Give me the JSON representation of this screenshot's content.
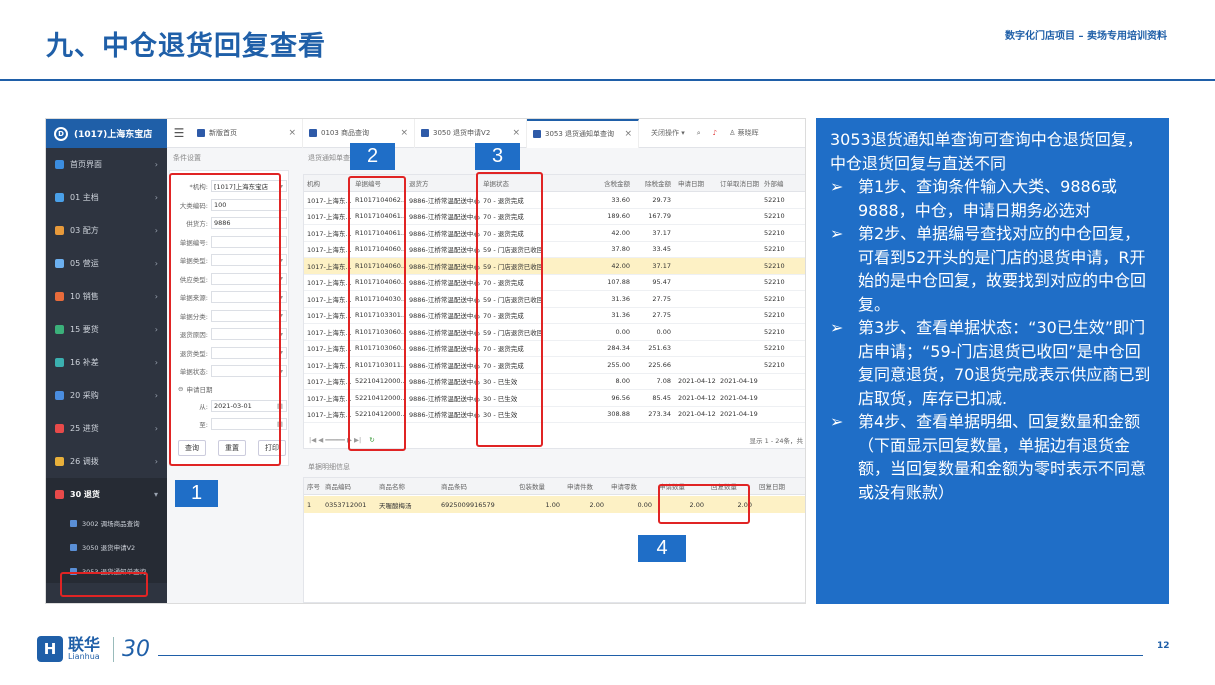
{
  "slide": {
    "title": "九、中仓退货回复查看",
    "subtitle": "数字化门店项目 – 卖场专用培训资料",
    "page": "12"
  },
  "sidebar": {
    "store": "(1017)上海东宝店",
    "items": [
      {
        "label": "首页界面",
        "color": "#3b8de0"
      },
      {
        "label": "01 主档",
        "color": "#4aa0e8"
      },
      {
        "label": "03 配方",
        "color": "#e89a3b"
      },
      {
        "label": "05 营运",
        "color": "#6cb0f0"
      },
      {
        "label": "10 销售",
        "color": "#e86b3b"
      },
      {
        "label": "15 要货",
        "color": "#3bb07a"
      },
      {
        "label": "16 补差",
        "color": "#3bb0b0"
      },
      {
        "label": "20 采购",
        "color": "#4a8de0"
      },
      {
        "label": "25 进货",
        "color": "#e84a4a"
      },
      {
        "label": "26 调拨",
        "color": "#e8b03b"
      },
      {
        "label": "30 退货",
        "color": "#e84a4a"
      }
    ],
    "sub_items": [
      {
        "label": "3002 调场商品查询"
      },
      {
        "label": "3050 退货申请V2"
      },
      {
        "label": "3053 退货通知单查询"
      }
    ]
  },
  "topbar": {
    "tabs": [
      {
        "label": "新版首页"
      },
      {
        "label": "0103 商品查询"
      },
      {
        "label": "3050 退货申请V2"
      },
      {
        "label": "3053 退货通知单查询"
      }
    ],
    "close_ops": "关闭操作 ▾",
    "user": "蔡晓晖"
  },
  "conditions": {
    "header": "条件设置",
    "fields": [
      {
        "label": "*机构:",
        "value": "[1017]上海东宝店",
        "dropdown": true
      },
      {
        "label": "大类编码:",
        "value": "100",
        "dropdown": false
      },
      {
        "label": "供货方:",
        "value": "9886",
        "dropdown": false
      },
      {
        "label": "单据编号:",
        "value": "",
        "dropdown": false
      },
      {
        "label": "单据类型:",
        "value": "",
        "dropdown": true
      },
      {
        "label": "供应类型:",
        "value": "",
        "dropdown": true
      },
      {
        "label": "单据来源:",
        "value": "",
        "dropdown": true
      },
      {
        "label": "单据分类:",
        "value": "",
        "dropdown": true
      },
      {
        "label": "退货原因:",
        "value": "",
        "dropdown": true
      },
      {
        "label": "退货类型:",
        "value": "",
        "dropdown": true
      },
      {
        "label": "单据状态:",
        "value": "",
        "dropdown": true
      }
    ],
    "date_group": "申请日期",
    "from_label": "从:",
    "from_value": "2021-03-01",
    "to_label": "至:",
    "to_value": "",
    "buttons": {
      "query": "查询",
      "reset": "重置",
      "print": "打印"
    }
  },
  "grid": {
    "title": "退货通知单查询",
    "columns": [
      "机构",
      "单据编号",
      "退货方",
      "单据状态",
      "含税金额",
      "除税金额",
      "申请日期",
      "订单取消日期",
      "外部编"
    ],
    "rows": [
      [
        "1017-上海东...",
        "R1017104062...",
        "9886-江桥常温配送中心...",
        "70 - 退货完成",
        "33.60",
        "29.73",
        "",
        "",
        "52210"
      ],
      [
        "1017-上海东...",
        "R1017104061...",
        "9886-江桥常温配送中心...",
        "70 - 退货完成",
        "189.60",
        "167.79",
        "",
        "",
        "52210"
      ],
      [
        "1017-上海东...",
        "R1017104061...",
        "9886-江桥常温配送中心...",
        "70 - 退货完成",
        "42.00",
        "37.17",
        "",
        "",
        "52210"
      ],
      [
        "1017-上海东...",
        "R1017104060...",
        "9886-江桥常温配送中心...",
        "59 - 门店退货已收回",
        "37.80",
        "33.45",
        "",
        "",
        "52210"
      ],
      [
        "1017-上海东...",
        "R1017104060...",
        "9886-江桥常温配送中心...",
        "59 - 门店退货已收回",
        "42.00",
        "37.17",
        "",
        "",
        "52210"
      ],
      [
        "1017-上海东...",
        "R1017104060...",
        "9886-江桥常温配送中心...",
        "70 - 退货完成",
        "107.88",
        "95.47",
        "",
        "",
        "52210"
      ],
      [
        "1017-上海东...",
        "R1017104030...",
        "9886-江桥常温配送中心...",
        "59 - 门店退货已收回",
        "31.36",
        "27.75",
        "",
        "",
        "52210"
      ],
      [
        "1017-上海东...",
        "R1017103301...",
        "9886-江桥常温配送中心...",
        "70 - 退货完成",
        "31.36",
        "27.75",
        "",
        "",
        "52210"
      ],
      [
        "1017-上海东...",
        "R1017103060...",
        "9886-江桥常温配送中心...",
        "59 - 门店退货已收回",
        "0.00",
        "0.00",
        "",
        "",
        "52210"
      ],
      [
        "1017-上海东...",
        "R1017103060...",
        "9886-江桥常温配送中心...",
        "70 - 退货完成",
        "284.34",
        "251.63",
        "",
        "",
        "52210"
      ],
      [
        "1017-上海东...",
        "R1017103011...",
        "9886-江桥常温配送中心...",
        "70 - 退货完成",
        "255.00",
        "225.66",
        "",
        "",
        "52210"
      ],
      [
        "1017-上海东...",
        "52210412000...",
        "9886-江桥常温配送中心...",
        "30 - 已生效",
        "8.00",
        "7.08",
        "2021-04-12",
        "2021-04-19",
        ""
      ],
      [
        "1017-上海东...",
        "52210412000...",
        "9886-江桥常温配送中心...",
        "30 - 已生效",
        "96.56",
        "85.45",
        "2021-04-12",
        "2021-04-19",
        ""
      ],
      [
        "1017-上海东...",
        "52210412000...",
        "9886-江桥常温配送中心...",
        "30 - 已生效",
        "308.88",
        "273.34",
        "2021-04-12",
        "2021-04-19",
        ""
      ]
    ],
    "footer": "显示 1 - 24条，共"
  },
  "detail": {
    "title": "单据明细信息",
    "columns": [
      "序号",
      "商品编码",
      "商品名称",
      "商品条码",
      "包装数量",
      "申请件数",
      "申请零数",
      "申请数量",
      "回复数量",
      "回复日期"
    ],
    "rows": [
      [
        "1",
        "0353712001",
        "天喔酸梅汤",
        "6925009916579",
        "1.00",
        "2.00",
        "0.00",
        "2.00",
        "2.00",
        ""
      ]
    ]
  },
  "markers": {
    "m1": "1",
    "m2": "2",
    "m3": "3",
    "m4": "4"
  },
  "panel": {
    "intro": "3053退货通知单查询可查询中仓退货回复，中仓退货回复与直送不同",
    "bullets": [
      "第1步、查询条件输入大类、9886或9888，中仓，申请日期务必选对",
      "第2步、单据编号查找对应的中仓回复，可看到52开头的是门店的退货申请，R开始的是中仓回复，故要找到对应的中仓回复。",
      "第3步、查看单据状态：“30已生效”即门店申请；“59-门店退货已收回”是中仓回复同意退货，70退货完成表示供应商已到店取货，库存已扣减.",
      "第4步、查看单据明细、回复数量和金额（下面显示回复数量，单据边有退货金额，当回复数量和金额为零时表示不同意或没有账款）"
    ],
    "arrow": "➢"
  },
  "footer": {
    "logo_cn": "联华",
    "logo_en": "Lianhua",
    "logo_30": "30",
    "logo_mark": "H"
  }
}
